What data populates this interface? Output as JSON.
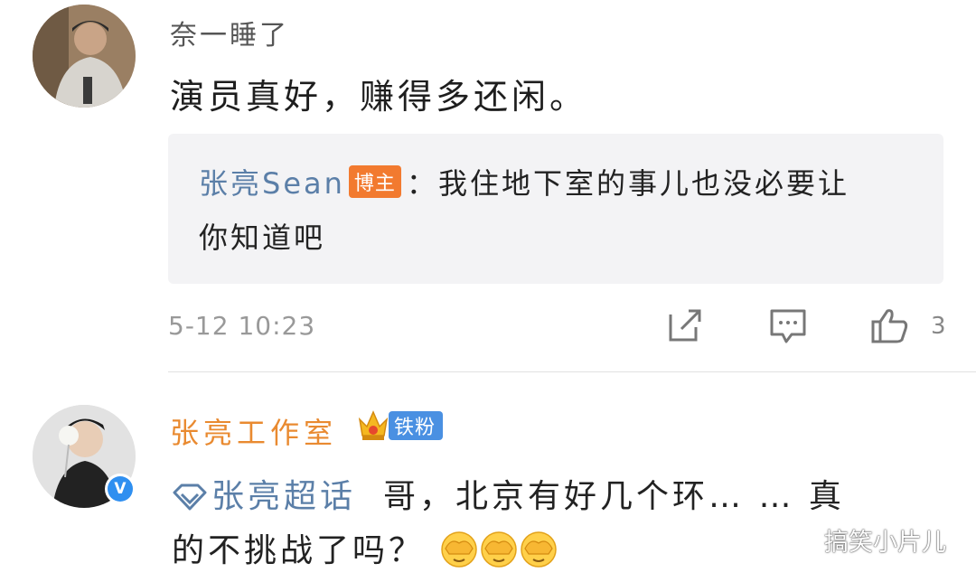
{
  "comment1": {
    "username": "奈一睡了",
    "text": "演员真好，赚得多还闲。",
    "reply": {
      "user": "张亮Sean",
      "badge": "博主",
      "separator": "：",
      "text_line1": "我住地下室的事儿也没必要让",
      "text_line2": "你知道吧"
    },
    "timestamp": "5-12 10:23",
    "actions": {
      "share_icon": "share-icon",
      "comment_icon": "comment-icon",
      "like_icon": "thumbs-up-icon",
      "like_count": "3"
    }
  },
  "comment2": {
    "username": "张亮工作室",
    "crown_icon": "crown-icon",
    "fan_badge": "铁粉",
    "topic": "张亮超话",
    "text_line1": "哥，北京有好几个环… … 真",
    "text_line2": "的不挑战了吗？",
    "emoji_icon": "facepalm-emoji",
    "emoji_count": 3,
    "verified_icon": "verified-v-icon",
    "verified_mark": "V"
  },
  "watermark": {
    "text": "搞笑小片儿",
    "icon": "wechat-icon"
  },
  "colors": {
    "link": "#5b7fa8",
    "orange": "#f27a2f",
    "username2": "#e98a30",
    "blue": "#4a90e2"
  }
}
